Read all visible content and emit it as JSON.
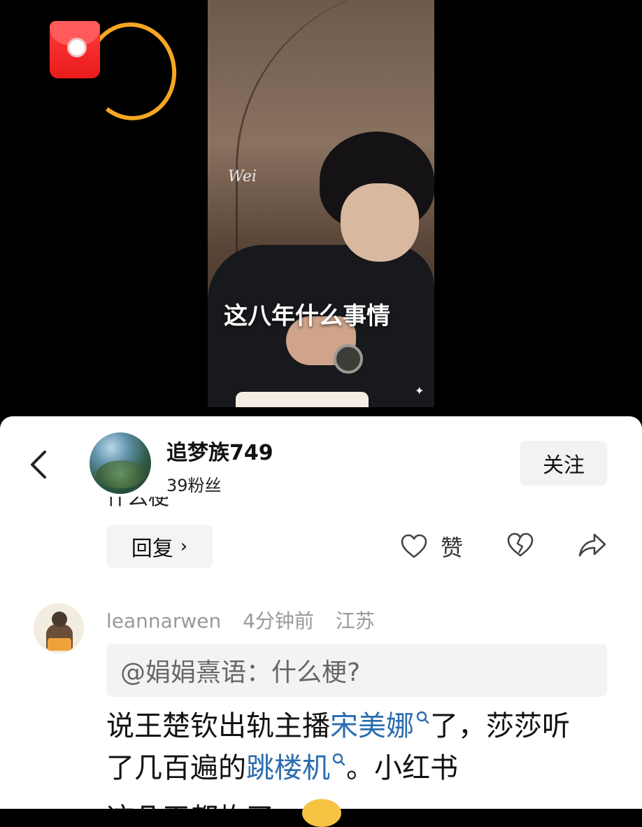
{
  "video": {
    "watermark": "Wei",
    "subtitle": "这八年什么事情",
    "redpacket_icon": "red-envelope-icon"
  },
  "author": {
    "name": "追梦族749",
    "fans": "39粉丝",
    "follow_label": "关注"
  },
  "first_comment": {
    "clipped_text": "什么梗"
  },
  "actions": {
    "reply_label": "回复",
    "reply_chevron": "›",
    "like_label": "赞"
  },
  "second_comment": {
    "user": "leannarwen",
    "time": "4分钟前",
    "location": "江苏",
    "quote": "@娟娟熹语：什么梗?",
    "body_part1": "说王楚钦出轨主播",
    "link1": "宋美娜",
    "body_part2": "了，莎莎听了几百遍的",
    "link2": "跳楼机",
    "body_part3": "。小红书",
    "body_line3": "这几天都炸了"
  },
  "colors": {
    "accent_link": "#2b6cb0",
    "ring": "#f5a623",
    "redpacket": "#e91a1a"
  }
}
